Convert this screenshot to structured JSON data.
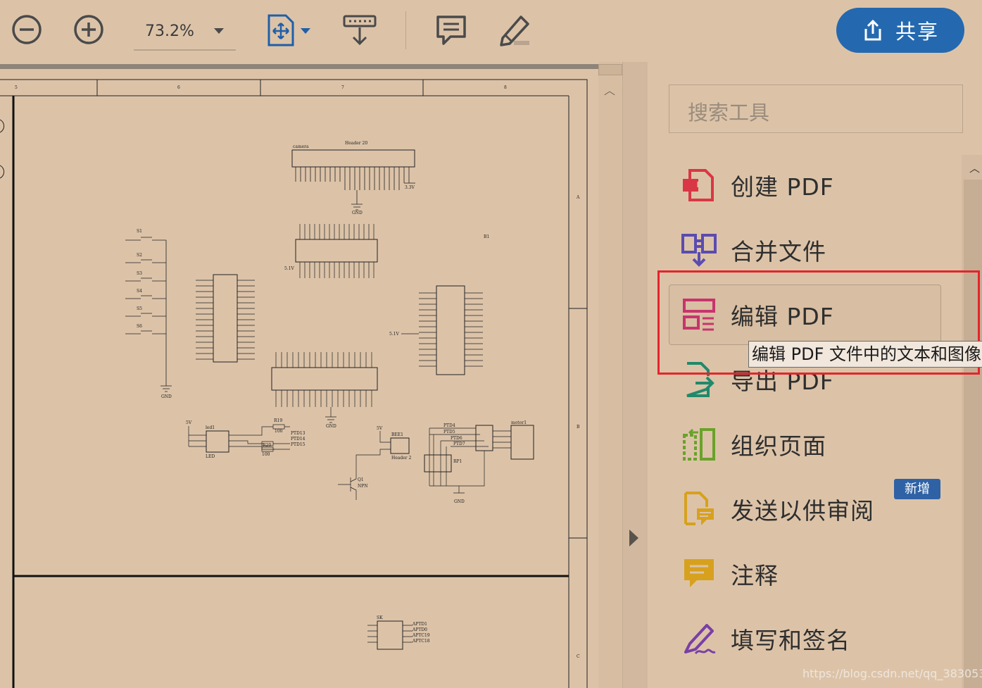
{
  "toolbar": {
    "zoom_out_icon": "zoom-out-icon",
    "zoom_in_icon": "zoom-in-icon",
    "zoom_value": "73.2%",
    "share_label": "共享"
  },
  "right_pane": {
    "search_placeholder": "搜索工具",
    "tools": [
      {
        "label": "创建 PDF",
        "icon": "create-pdf-icon",
        "color": "#d93745"
      },
      {
        "label": "合并文件",
        "icon": "combine-files-icon",
        "color": "#5b4cb0"
      },
      {
        "label": "编辑 PDF",
        "icon": "edit-pdf-icon",
        "color": "#c8346d"
      },
      {
        "label": "导出 PDF",
        "icon": "export-pdf-icon",
        "color": "#1f8a6b"
      },
      {
        "label": "组织页面",
        "icon": "organize-pages-icon",
        "color": "#6aa22a"
      },
      {
        "label": "发送以供审阅",
        "icon": "send-for-review-icon",
        "color": "#d7a11e"
      },
      {
        "label": "注释",
        "icon": "comment-icon",
        "color": "#d7a11e"
      },
      {
        "label": "填写和签名",
        "icon": "fill-sign-icon",
        "color": "#7a3fa6"
      }
    ],
    "new_badge": "新增",
    "tooltip": "编辑 PDF 文件中的文本和图像"
  },
  "document": {
    "col_numbers": [
      "5",
      "6",
      "7",
      "8"
    ],
    "row_letters": [
      "A",
      "B",
      "C"
    ],
    "schematic_labels": {
      "camera": "camera",
      "header20": "Header 20",
      "gnd": "GND",
      "b1": "B1",
      "switches": [
        "S1",
        "S2",
        "S3",
        "S4",
        "S5",
        "S6"
      ],
      "led": "led1",
      "led_caption": "LED",
      "r19": "R19",
      "r20": "R20",
      "r_value": "100",
      "bee": "BEE1",
      "header2": "Header 2",
      "q1": "Q1",
      "npn": "NPN",
      "rp1": "RP1",
      "motor": "motor1",
      "sk": "SK",
      "v33": "3.3V",
      "v5": "5V",
      "v51": "5.1V",
      "ptd": [
        "PTD13",
        "PTD14",
        "PTD15"
      ],
      "ptd_motor": [
        "PTD4",
        "PTD5",
        "PTD6",
        "PTD7"
      ],
      "aptd": [
        "APTD1",
        "APTD0",
        "APTC19",
        "APTC18"
      ]
    }
  },
  "watermark": "https://blog.csdn.net/qq_38305370"
}
